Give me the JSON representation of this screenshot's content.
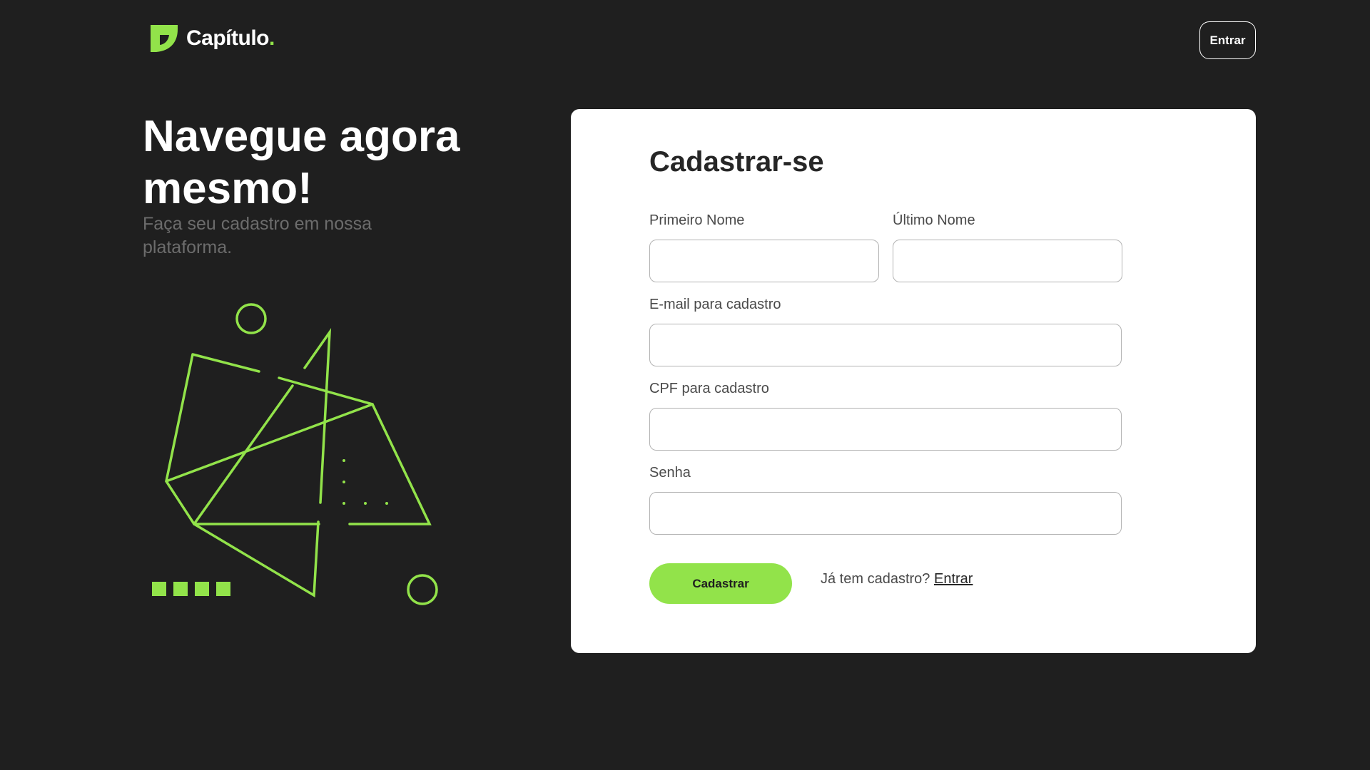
{
  "header": {
    "logo_text": "Capítulo",
    "logo_dot": ".",
    "login_label": "Entrar"
  },
  "hero": {
    "title": "Navegue agora mesmo!",
    "subtitle": "Faça seu cadastro em nossa plataforma."
  },
  "form": {
    "title": "Cadastrar-se",
    "fields": {
      "first_name": {
        "label": "Primeiro Nome",
        "value": ""
      },
      "last_name": {
        "label": "Último Nome",
        "value": ""
      },
      "email": {
        "label": "E-mail para cadastro",
        "value": ""
      },
      "cpf": {
        "label": "CPF para cadastro",
        "value": ""
      },
      "password": {
        "label": "Senha",
        "value": ""
      }
    },
    "submit_label": "Cadastrar",
    "login_prompt": "Já tem cadastro?",
    "login_link": "Entrar"
  },
  "icons": {
    "logo": "book-leaf-icon",
    "illustration": "geometric-shapes-illustration"
  },
  "colors": {
    "background": "#1f1f1f",
    "accent": "#92e34a",
    "card": "#ffffff",
    "muted_text": "#6c6c6c"
  }
}
